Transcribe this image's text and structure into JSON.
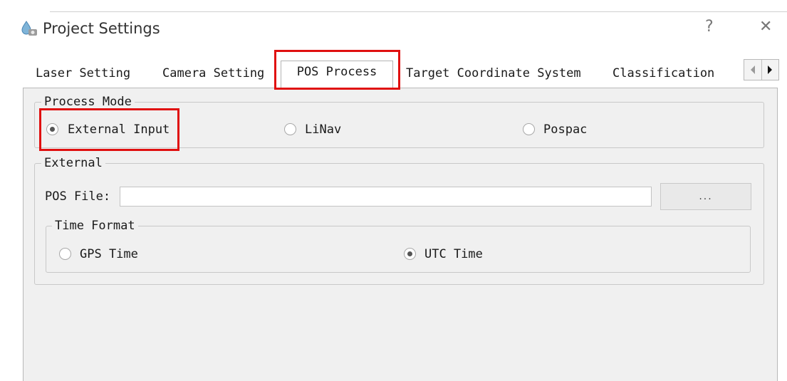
{
  "window": {
    "title": "Project Settings",
    "help_glyph": "?",
    "close_glyph": "✕"
  },
  "tabs": [
    {
      "label": "Laser Setting"
    },
    {
      "label": "Camera Setting"
    },
    {
      "label": "POS Process",
      "active": true
    },
    {
      "label": "Target Coordinate System"
    },
    {
      "label": "Classification"
    }
  ],
  "process_mode": {
    "title": "Process Mode",
    "options": [
      {
        "label": "External Input",
        "checked": true
      },
      {
        "label": "LiNav",
        "checked": false
      },
      {
        "label": "Pospac",
        "checked": false
      }
    ]
  },
  "external": {
    "title": "External",
    "pos_file_label": "POS File:",
    "pos_file_value": "",
    "browse_label": "...",
    "time_format": {
      "title": "Time Format",
      "options": [
        {
          "label": "GPS Time",
          "checked": false
        },
        {
          "label": "UTC Time",
          "checked": true
        }
      ]
    }
  },
  "colors": {
    "highlight": "#e01010",
    "panel_bg": "#f0f0f0"
  },
  "icons": [
    "app-icon",
    "help-icon",
    "close-icon",
    "scroll-left-icon",
    "scroll-right-icon"
  ]
}
